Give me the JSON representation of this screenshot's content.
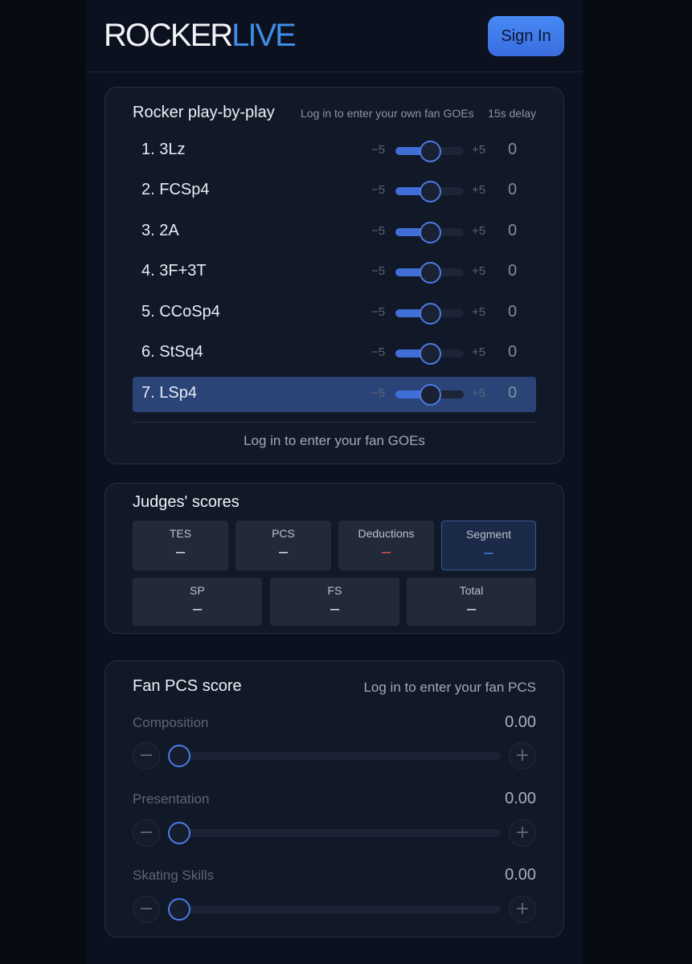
{
  "header": {
    "logo_part1": "ROCKER",
    "logo_part2": "LIVE",
    "sign_in_label": "Sign In"
  },
  "play_by_play": {
    "title": "Rocker play-by-play",
    "hint": "Log in to enter your own fan GOEs",
    "delay": "15s delay",
    "min_label": "−5",
    "max_label": "+5",
    "elements": [
      {
        "label": "1. 3Lz",
        "goe": "0",
        "slider_value": 0
      },
      {
        "label": "2. FCSp4",
        "goe": "0",
        "slider_value": 0
      },
      {
        "label": "3. 2A",
        "goe": "0",
        "slider_value": 0
      },
      {
        "label": "4. 3F+3T",
        "goe": "0",
        "slider_value": 0
      },
      {
        "label": "5. CCoSp4",
        "goe": "0",
        "slider_value": 0
      },
      {
        "label": "6. StSq4",
        "goe": "0",
        "slider_value": 0
      },
      {
        "label": "7. LSp4",
        "goe": "0",
        "slider_value": 0,
        "active": true
      }
    ],
    "footer": "Log in to enter your fan GOEs"
  },
  "judges": {
    "title": "Judges' scores",
    "tes": {
      "label": "TES",
      "value": "–"
    },
    "pcs": {
      "label": "PCS",
      "value": "–"
    },
    "deductions": {
      "label": "Deductions",
      "value": "–"
    },
    "segment": {
      "label": "Segment",
      "value": "–"
    },
    "sp": {
      "label": "SP",
      "value": "–"
    },
    "fs": {
      "label": "FS",
      "value": "–"
    },
    "total": {
      "label": "Total",
      "value": "–"
    }
  },
  "fan_pcs": {
    "title": "Fan PCS score",
    "hint": "Log in to enter your fan PCS",
    "minus_label": "−",
    "plus_label": "+",
    "components": [
      {
        "label": "Composition",
        "value": "0.00"
      },
      {
        "label": "Presentation",
        "value": "0.00"
      },
      {
        "label": "Skating Skills",
        "value": "0.00"
      }
    ]
  },
  "colors": {
    "accent": "#3f8de6",
    "active_row": "#2b4478",
    "deduction": "#e5534b"
  }
}
